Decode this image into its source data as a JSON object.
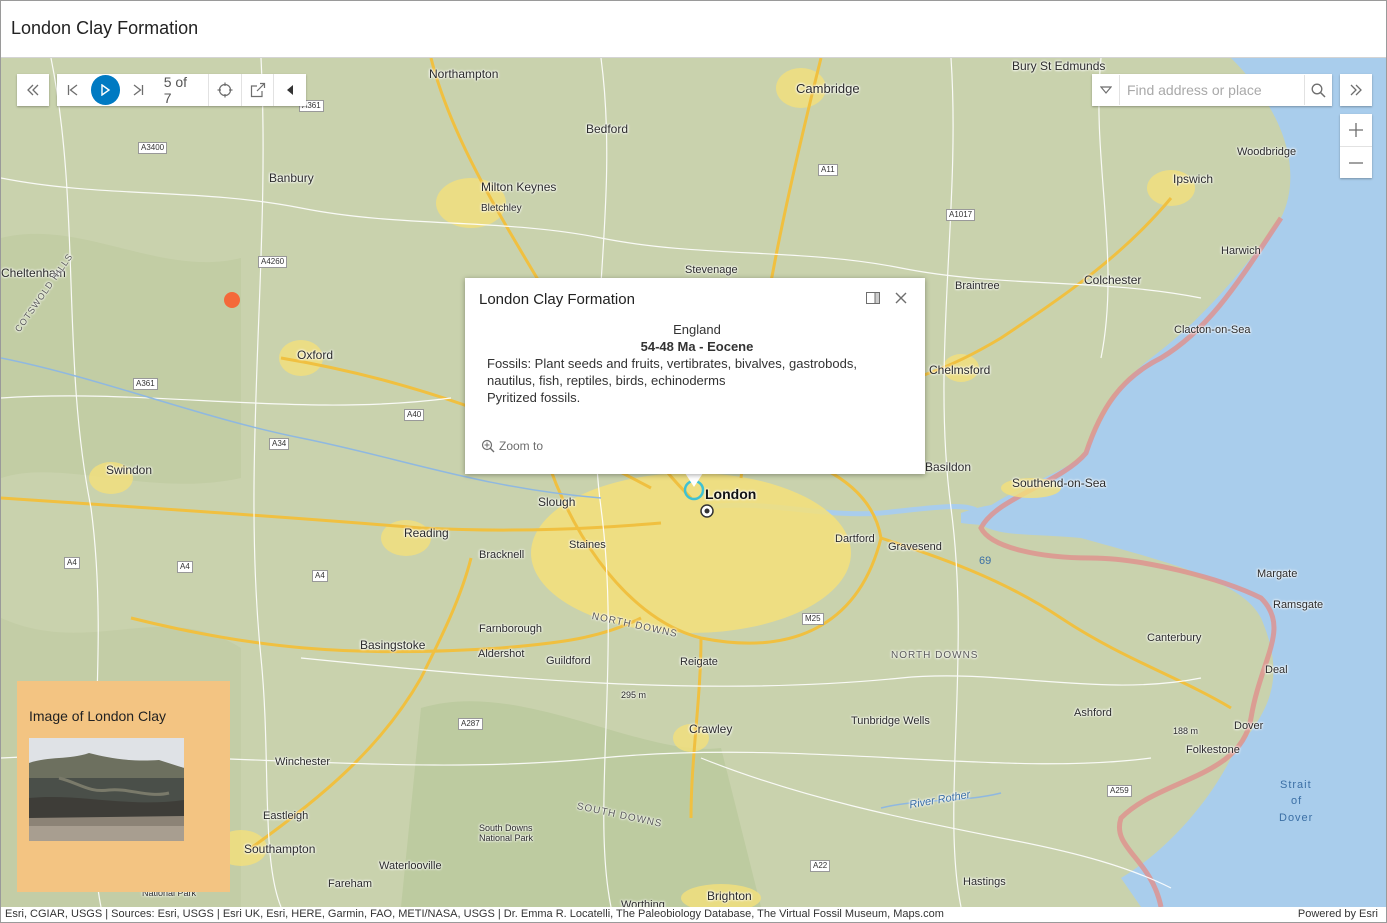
{
  "header": {
    "title": "London Clay Formation"
  },
  "toolbar": {
    "counter": "5 of 7",
    "icons": [
      "double-chevron-left-icon",
      "skip-back-icon",
      "play-icon",
      "skip-forward-icon",
      "crosshair-icon",
      "share-icon",
      "caret-left-icon"
    ]
  },
  "search": {
    "placeholder": "Find address or place"
  },
  "zoom": {
    "in_label": "+",
    "out_label": "−"
  },
  "popup": {
    "title": "London Clay Formation",
    "country": "England",
    "age": "54-48 Ma - Eocene",
    "fossils": "Fossils: Plant seeds and fruits, vertibrates, bivalves, gastrobods, nautilus, fish, reptiles, birds, echinoderms",
    "note": "Pyritized fossils.",
    "zoom_to": "Zoom to"
  },
  "legend_card": {
    "title": "Image of London Clay"
  },
  "attribution": {
    "sources": "Esri, CGIAR, USGS | Sources: Esri, USGS | Esri UK, Esri, HERE, Garmin, FAO, METI/NASA, USGS | Dr. Emma R. Locatelli, The Paleobiology Database, The Virtual Fossil Museum, Maps.com",
    "powered": "Powered by Esri"
  },
  "map": {
    "places": [
      "Bury St Edmunds",
      "Northampton",
      "Cambridge",
      "Bedford",
      "Woodbridge",
      "Banbury",
      "Milton Keynes",
      "Bletchley",
      "Ipswich",
      "Harwich",
      "Cheltenham",
      "Stevenage",
      "Colchester",
      "Braintree",
      "Clacton-on-Sea",
      "Oxford",
      "Chelmsford",
      "Swindon",
      "Basildon",
      "Southend-on-Sea",
      "Slough",
      "London",
      "Reading",
      "Bracknell",
      "Staines",
      "Dartford",
      "Gravesend",
      "Margate",
      "Ramsgate",
      "Farnborough",
      "Aldershot",
      "Guildford",
      "Reigate",
      "Basingstoke",
      "Canterbury",
      "Deal",
      "Crawley",
      "Tunbridge Wells",
      "Ashford",
      "Dover",
      "Folkestone",
      "Winchester",
      "Eastleigh",
      "Southampton",
      "Waterlooville",
      "Fareham",
      "Brighton",
      "Worthing",
      "Hastings",
      "South Downs National Park",
      "National Park"
    ],
    "roads": [
      "A361",
      "A3400",
      "A4260",
      "A361",
      "A40",
      "A34",
      "A4",
      "A4",
      "A4",
      "A11",
      "A1017",
      "A287",
      "A22",
      "A259",
      "M25"
    ],
    "features": [
      "COTSWOLD HILLS",
      "NORTH DOWNS",
      "NORTH DOWNS",
      "SOUTH DOWNS",
      "River Rother",
      "Strait",
      "of",
      "Dover",
      "295 m",
      "188 m",
      "69"
    ],
    "colors": {
      "land": "#c9d2ad",
      "urban": "#f4e07a",
      "water": "#a9cdec",
      "highway": "#f0c040",
      "boundary": "#e0908c"
    }
  }
}
